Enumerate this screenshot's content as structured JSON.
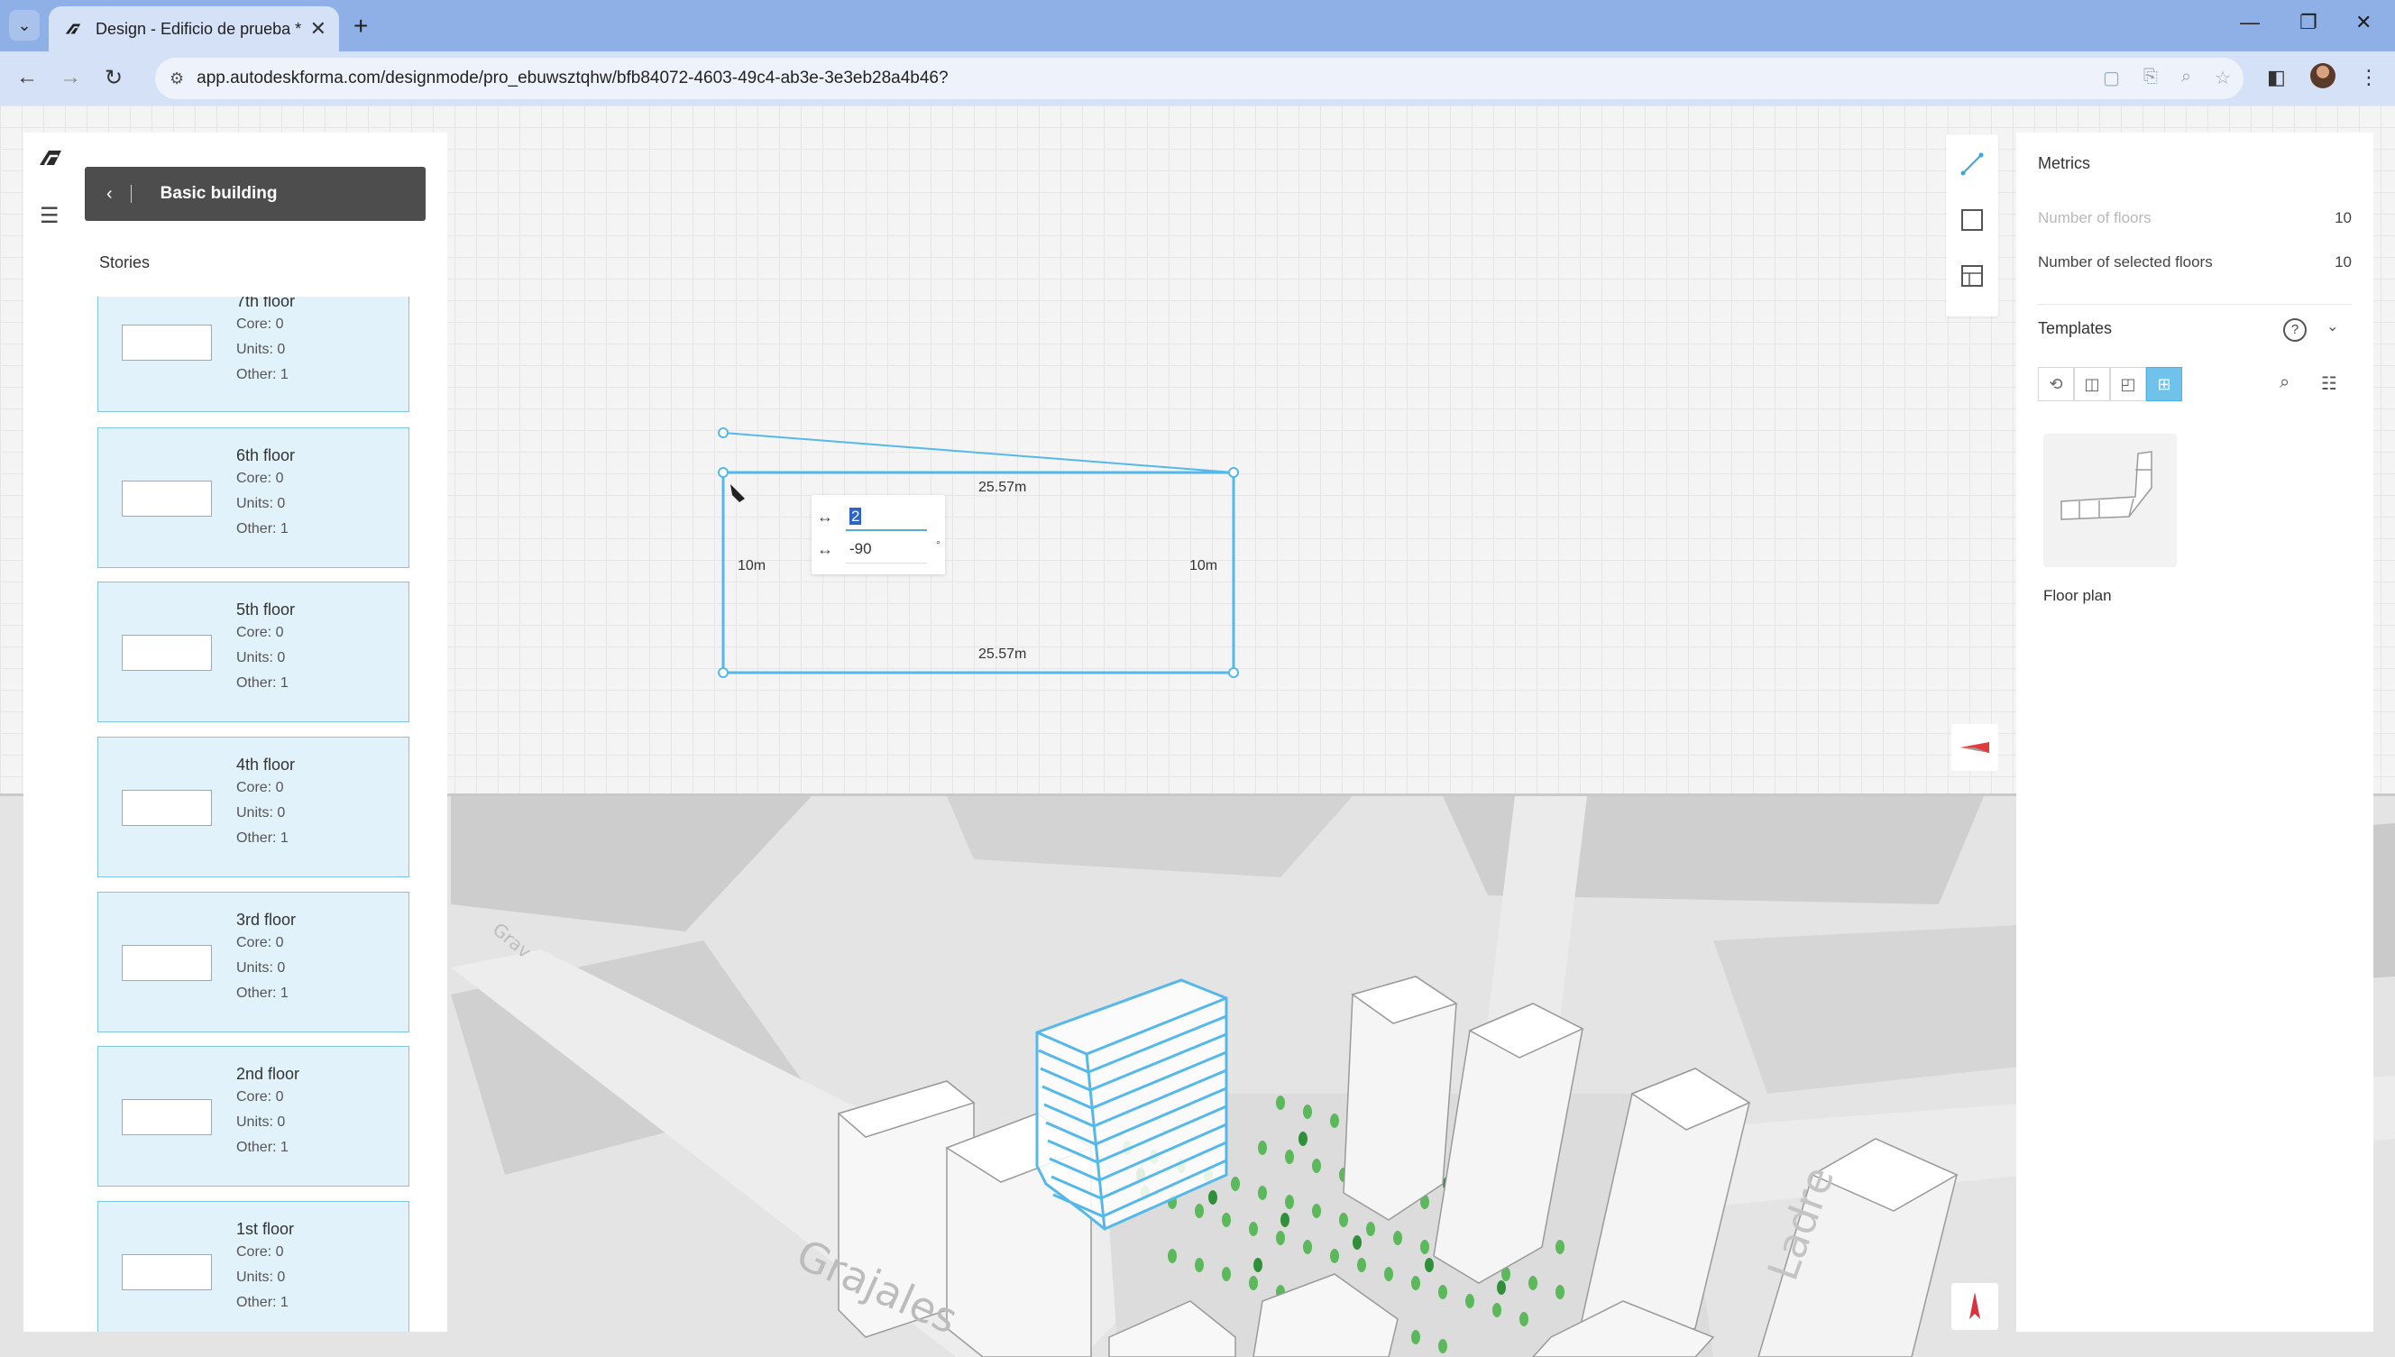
{
  "browser": {
    "tab_title": "Design - Edificio de prueba *",
    "url": "app.autodeskforma.com/designmode/pro_ebuwsztqhw/bfb84072-4603-49c4-ab3e-3e3eb28a4b46?",
    "new_tab": "+",
    "close_glyph": "✕",
    "dropdown_glyph": "⌄",
    "min_glyph": "—",
    "max_glyph": "❐",
    "back_glyph": "←",
    "forward_glyph": "→",
    "reload_glyph": "↻"
  },
  "panel": {
    "header_title": "Basic building",
    "section": "Stories",
    "stories": [
      {
        "name": "7th floor",
        "core": "Core: 0",
        "units": "Units: 0",
        "other": "Other: 1"
      },
      {
        "name": "6th floor",
        "core": "Core: 0",
        "units": "Units: 0",
        "other": "Other: 1"
      },
      {
        "name": "5th floor",
        "core": "Core: 0",
        "units": "Units: 0",
        "other": "Other: 1"
      },
      {
        "name": "4th floor",
        "core": "Core: 0",
        "units": "Units: 0",
        "other": "Other: 1"
      },
      {
        "name": "3rd floor",
        "core": "Core: 0",
        "units": "Units: 0",
        "other": "Other: 1"
      },
      {
        "name": "2nd floor",
        "core": "Core: 0",
        "units": "Units: 0",
        "other": "Other: 1"
      },
      {
        "name": "1st floor",
        "core": "Core: 0",
        "units": "Units: 0",
        "other": "Other: 1"
      }
    ]
  },
  "plan": {
    "dim_top": "25.57m",
    "dim_bottom": "25.57m",
    "dim_left": "10m",
    "dim_right": "10m",
    "edit_value_1": "2",
    "edit_value_2": "-90",
    "degree": "°"
  },
  "map": {
    "street_1": "Grajales",
    "street_2": "Ladre",
    "street_3": "Grav"
  },
  "metrics": {
    "title": "Metrics",
    "rows": [
      {
        "label": "Number of floors",
        "value": "10"
      },
      {
        "label": "Number of selected floors",
        "value": "10"
      }
    ],
    "templates_label": "Templates",
    "help": "?",
    "card_label": "Floor plan"
  },
  "colors": {
    "accent": "#4ab2e2",
    "selection": "#55b8ea",
    "story_bg": "#e1f2fb",
    "header_bg": "#4d4d4d"
  }
}
